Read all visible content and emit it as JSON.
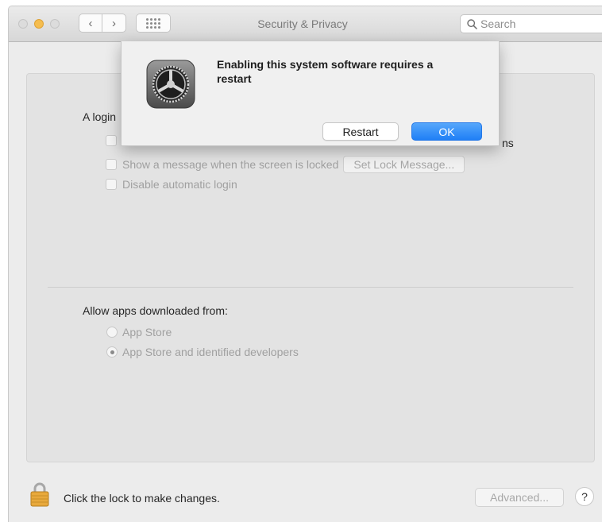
{
  "window": {
    "title": "Security & Privacy",
    "search_placeholder": "Search"
  },
  "nav": {
    "back_glyph": "‹",
    "forward_glyph": "›"
  },
  "login_section": {
    "heading_visible": "A login",
    "hidden_row_suffix": "ns",
    "show_message_label": "Show a message when the screen is locked",
    "set_lock_message_label": "Set Lock Message...",
    "disable_auto_login_label": "Disable automatic login"
  },
  "allow_apps_section": {
    "heading": "Allow apps downloaded from:",
    "options": [
      {
        "label": "App Store",
        "selected": false
      },
      {
        "label": "App Store and identified developers",
        "selected": true
      }
    ]
  },
  "footer": {
    "lock_text": "Click the lock to make changes.",
    "advanced_label": "Advanced...",
    "help_label": "?"
  },
  "dialog": {
    "icon": "system-preferences-gear-icon",
    "message": "Enabling this system software requires a restart",
    "restart_label": "Restart",
    "ok_label": "OK"
  },
  "colors": {
    "accent": "#1f7ff6",
    "minimize": "#f5bd4f",
    "lock": "#e8a93c"
  }
}
